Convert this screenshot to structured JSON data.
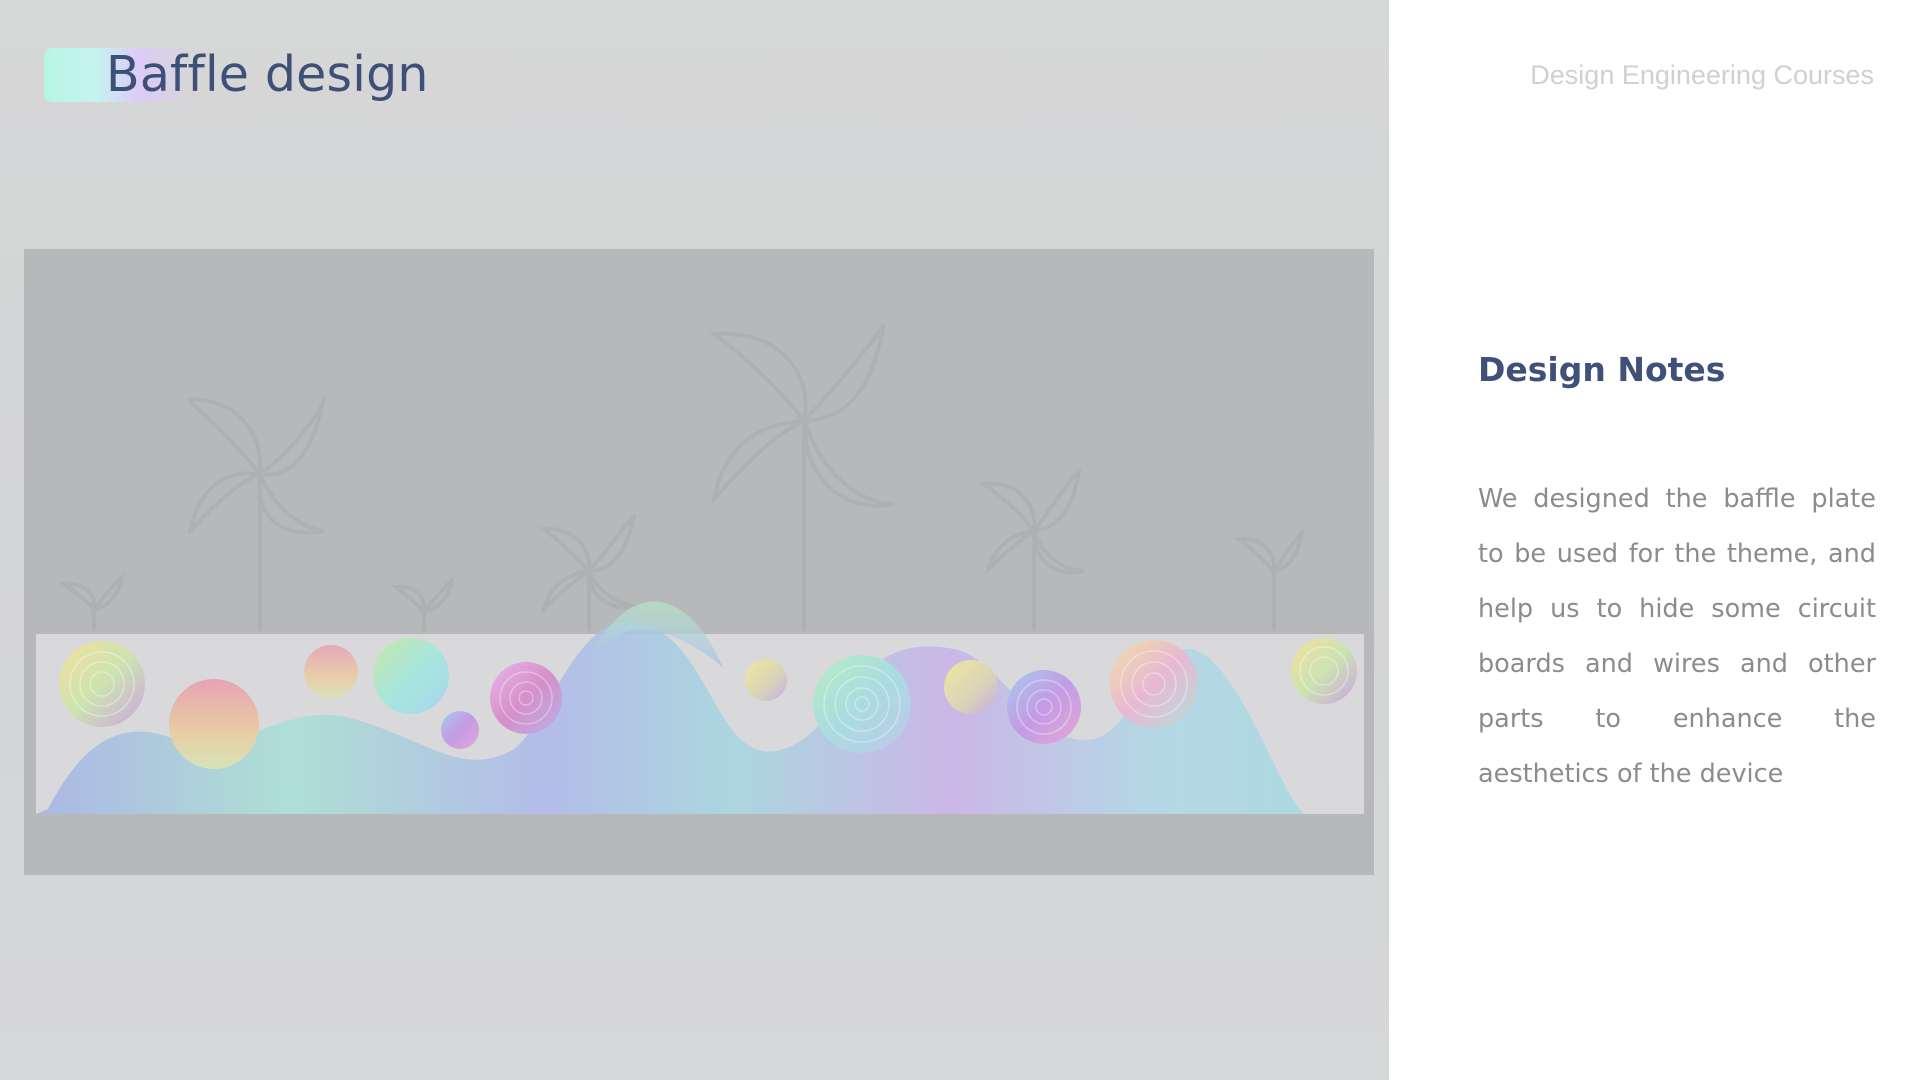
{
  "header": {
    "title": "Baffle design",
    "course": "Design Engineering Courses"
  },
  "figure": {
    "description_icon": "baffle-render-image"
  },
  "notes": {
    "title": "Design Notes",
    "body": "We designed the baffle plate to be used for the theme, and help us to hide some circuit boards and wires and other parts to enhance the aesthetics of the device"
  },
  "colors": {
    "title": "#3e4f78",
    "body_text": "#8b8c8f",
    "panel_bg": "#d6d7d7",
    "figure_bg": "#b7b8b9"
  }
}
